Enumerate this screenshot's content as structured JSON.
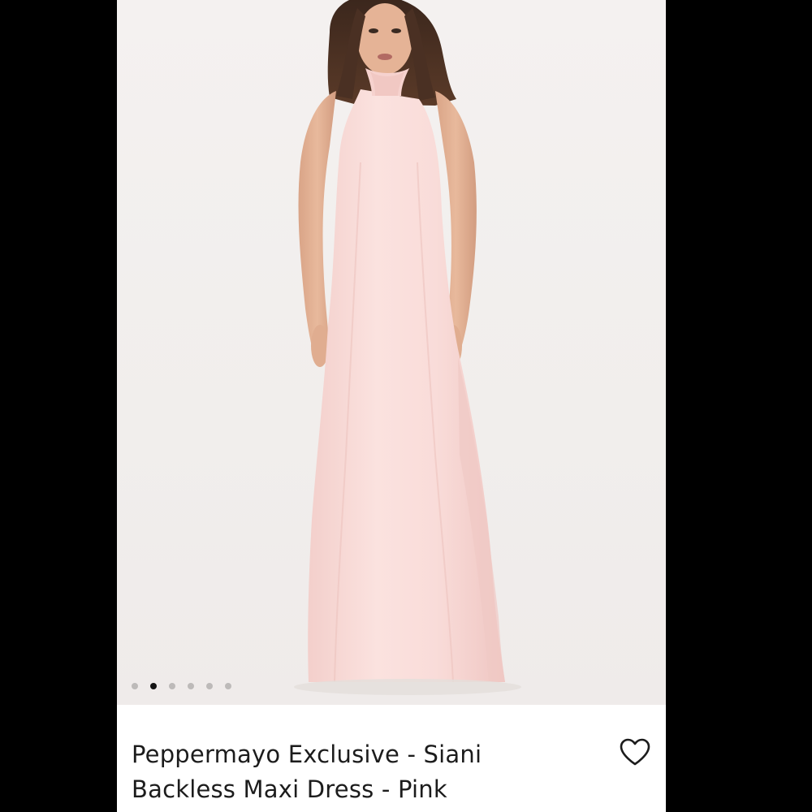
{
  "gallery": {
    "image_alt": "Model wearing a pink satin halter neck backless maxi dress",
    "page_count": 6,
    "active_index": 1
  },
  "product": {
    "title_line1": "Peppermayo Exclusive - Siani",
    "title_line2": "Backless Maxi Dress - Pink"
  },
  "icons": {
    "wishlist": "heart-outline-icon"
  },
  "colors": {
    "dress": "#f7d6d3",
    "background": "#f2efed",
    "dot_active": "#141414",
    "dot_inactive": "#bdbab9"
  }
}
